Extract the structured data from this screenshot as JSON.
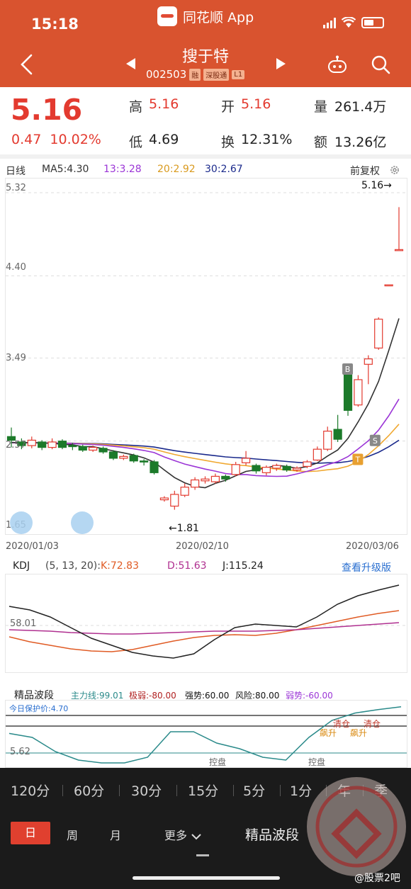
{
  "status_bar": {
    "time": "15:18",
    "app_name": "同花顺 App"
  },
  "header": {
    "stock_name": "搜于特",
    "stock_code": "002503",
    "tags": [
      "融",
      "深股通",
      "L1"
    ]
  },
  "quote": {
    "price": "5.16",
    "change": "0.47",
    "change_pct": "10.02%",
    "high_label": "高",
    "high": "5.16",
    "low_label": "低",
    "low": "4.69",
    "open_label": "开",
    "open": "5.16",
    "turnover_label": "换",
    "turnover": "12.31%",
    "volume_label": "量",
    "volume": "261.4万",
    "amount_label": "额",
    "amount": "13.26亿"
  },
  "ma_legend": {
    "period": "日线",
    "ma5": "MA5:4.30",
    "ma13": "13:3.28",
    "ma20": "20:2.92",
    "ma30": "30:2.67",
    "restore": "前复权",
    "colors": {
      "ma5": "#333333",
      "ma13": "#9b35d6",
      "ma20": "#f0a830",
      "ma30": "#1b2a8c",
      "up": "#e33a2f",
      "down": "#1c7a2a"
    }
  },
  "chart_data": [
    {
      "type": "candlestick",
      "title": "",
      "y_ticks": [
        "5.32",
        "4.40",
        "3.49",
        "2.57",
        "1.65"
      ],
      "ylim": [
        1.65,
        5.32
      ],
      "x_ticks": [
        "2020/01/03",
        "2020/02/10",
        "2020/03/06"
      ],
      "high_marker": "5.16→",
      "low_marker": "←1.81",
      "signals": [
        "B",
        "S",
        "T"
      ],
      "candles": [
        {
          "o": 2.62,
          "c": 2.58,
          "h": 2.72,
          "l": 2.5
        },
        {
          "o": 2.56,
          "c": 2.52,
          "h": 2.6,
          "l": 2.48
        },
        {
          "o": 2.52,
          "c": 2.58,
          "h": 2.62,
          "l": 2.49
        },
        {
          "o": 2.56,
          "c": 2.5,
          "h": 2.58,
          "l": 2.47
        },
        {
          "o": 2.5,
          "c": 2.56,
          "h": 2.6,
          "l": 2.48
        },
        {
          "o": 2.57,
          "c": 2.5,
          "h": 2.59,
          "l": 2.48
        },
        {
          "o": 2.52,
          "c": 2.51,
          "h": 2.55,
          "l": 2.47
        },
        {
          "o": 2.51,
          "c": 2.47,
          "h": 2.53,
          "l": 2.45
        },
        {
          "o": 2.47,
          "c": 2.5,
          "h": 2.52,
          "l": 2.45
        },
        {
          "o": 2.49,
          "c": 2.45,
          "h": 2.51,
          "l": 2.43
        },
        {
          "o": 2.45,
          "c": 2.38,
          "h": 2.47,
          "l": 2.36
        },
        {
          "o": 2.38,
          "c": 2.4,
          "h": 2.42,
          "l": 2.36
        },
        {
          "o": 2.41,
          "c": 2.35,
          "h": 2.43,
          "l": 2.33
        },
        {
          "o": 2.35,
          "c": 2.34,
          "h": 2.37,
          "l": 2.3
        },
        {
          "o": 2.34,
          "c": 2.22,
          "h": 2.36,
          "l": 2.2
        },
        {
          "o": 1.92,
          "c": 1.94,
          "h": 1.96,
          "l": 1.9
        },
        {
          "o": 1.85,
          "c": 1.98,
          "h": 2.02,
          "l": 1.81
        },
        {
          "o": 1.97,
          "c": 2.06,
          "h": 2.1,
          "l": 1.95
        },
        {
          "o": 2.06,
          "c": 2.14,
          "h": 2.17,
          "l": 2.03
        },
        {
          "o": 2.13,
          "c": 2.15,
          "h": 2.18,
          "l": 2.1
        },
        {
          "o": 2.12,
          "c": 2.18,
          "h": 2.21,
          "l": 2.1
        },
        {
          "o": 2.18,
          "c": 2.15,
          "h": 2.2,
          "l": 2.12
        },
        {
          "o": 2.2,
          "c": 2.31,
          "h": 2.34,
          "l": 2.18
        },
        {
          "o": 2.33,
          "c": 2.38,
          "h": 2.46,
          "l": 2.3
        },
        {
          "o": 2.3,
          "c": 2.24,
          "h": 2.32,
          "l": 2.21
        },
        {
          "o": 2.22,
          "c": 2.28,
          "h": 2.3,
          "l": 2.19
        },
        {
          "o": 2.27,
          "c": 2.3,
          "h": 2.32,
          "l": 2.24
        },
        {
          "o": 2.29,
          "c": 2.25,
          "h": 2.31,
          "l": 2.23
        },
        {
          "o": 2.25,
          "c": 2.27,
          "h": 2.29,
          "l": 2.23
        },
        {
          "o": 2.29,
          "c": 2.34,
          "h": 2.36,
          "l": 2.27
        },
        {
          "o": 2.36,
          "c": 2.48,
          "h": 2.51,
          "l": 2.35
        },
        {
          "o": 2.48,
          "c": 2.68,
          "h": 2.73,
          "l": 2.46
        },
        {
          "o": 2.7,
          "c": 2.59,
          "h": 2.86,
          "l": 2.56
        },
        {
          "o": 3.33,
          "c": 2.91,
          "h": 3.36,
          "l": 2.85
        },
        {
          "o": 2.97,
          "c": 3.25,
          "h": 3.3,
          "l": 2.95
        },
        {
          "o": 3.42,
          "c": 3.48,
          "h": 3.52,
          "l": 3.2
        },
        {
          "o": 3.6,
          "c": 3.92,
          "h": 3.94,
          "l": 3.58
        },
        {
          "o": 4.3,
          "c": 4.3,
          "h": 4.3,
          "l": 4.3
        },
        {
          "o": 4.69,
          "c": 4.69,
          "h": 5.16,
          "l": 4.69
        }
      ]
    },
    {
      "type": "line",
      "title": "KDJ",
      "y_ticks": [
        "58.01"
      ],
      "series": [
        {
          "name": "K:72.83",
          "values": [
            42,
            35,
            30,
            25,
            22,
            21,
            24,
            30,
            36,
            41,
            44,
            45,
            44,
            47,
            52,
            58,
            64,
            70,
            75,
            79
          ]
        },
        {
          "name": "D:51.63",
          "values": [
            52,
            51,
            50,
            48,
            47,
            46,
            46,
            47,
            48,
            49,
            50,
            50,
            50,
            51,
            52,
            54,
            56,
            58,
            60,
            62
          ]
        },
        {
          "name": "J:115.24",
          "values": [
            85,
            80,
            70,
            55,
            40,
            30,
            20,
            15,
            12,
            18,
            38,
            55,
            60,
            58,
            56,
            70,
            88,
            100,
            108,
            115
          ]
        }
      ]
    },
    {
      "type": "line",
      "title": "精品波段",
      "y_ticks": [
        "5.62"
      ],
      "series": [
        {
          "name": "主力线:99.01",
          "values": [
            52,
            45,
            20,
            5,
            0,
            0,
            10,
            55,
            55,
            35,
            25,
            10,
            5,
            45,
            75,
            88,
            94,
            99
          ]
        }
      ]
    }
  ],
  "kdj": {
    "label": "KDJ",
    "params": "(5, 13, 20):",
    "k": "K:72.83",
    "d": "D:51.63",
    "j": "J:115.24",
    "upgrade": "查看升级版"
  },
  "jingpin": {
    "label": "精品波段",
    "main": "主力线:99.01",
    "extreme_weak": "极弱:-80.00",
    "strong": "强势:60.00",
    "risk": "风险:80.00",
    "weak": "弱势:-60.00",
    "protect": "今日保护价:4.70",
    "tick": "5.62",
    "annotations": [
      "清仓",
      "清仓",
      "飙升",
      "飙升",
      "控盘",
      "控盘"
    ]
  },
  "periods": [
    "120分",
    "60分",
    "30分",
    "15分",
    "5分",
    "1分",
    "年",
    "季"
  ],
  "cycles": {
    "day": "日",
    "week": "周",
    "month": "月",
    "more": "更多"
  },
  "bottom_tab": "精品波段",
  "watermark": "@股票2吧"
}
